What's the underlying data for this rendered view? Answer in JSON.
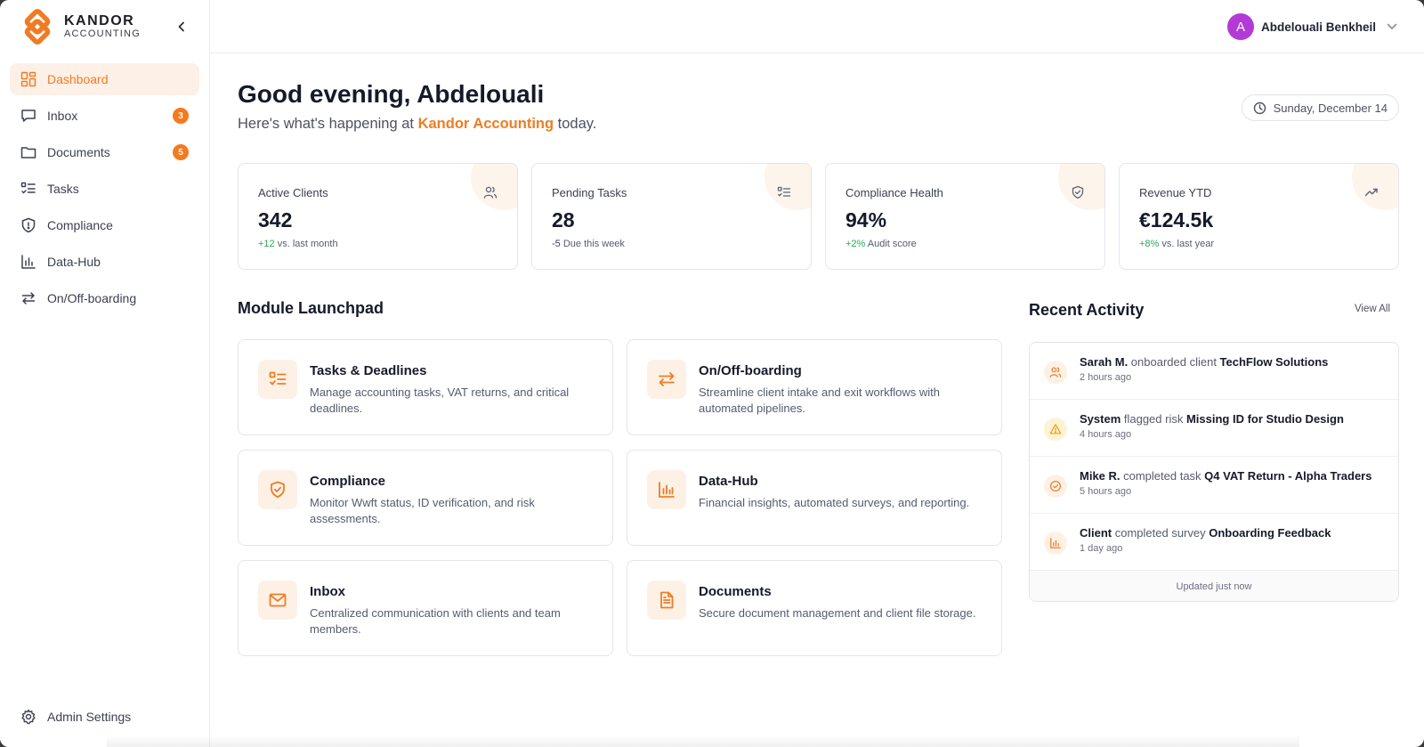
{
  "colors": {
    "accent": "#ef7d22",
    "badge": "#f47a20",
    "positive": "#2aa85a",
    "avatar": "#b33ad6",
    "warning": "#e8a10f"
  },
  "brand": {
    "name": "KANDOR",
    "sub": "ACCOUNTING"
  },
  "sidebar": {
    "collapse_icon": "chevron-left-icon",
    "items": [
      {
        "label": "Dashboard",
        "icon": "dashboard-icon",
        "active": true
      },
      {
        "label": "Inbox",
        "icon": "message-icon",
        "badge": "3"
      },
      {
        "label": "Documents",
        "icon": "folder-icon",
        "badge": "5"
      },
      {
        "label": "Tasks",
        "icon": "task-list-icon"
      },
      {
        "label": "Compliance",
        "icon": "shield-icon"
      },
      {
        "label": "Data-Hub",
        "icon": "bar-chart-icon"
      },
      {
        "label": "On/Off-boarding",
        "icon": "transfer-icon"
      }
    ],
    "admin": {
      "label": "Admin Settings",
      "icon": "gear-icon"
    }
  },
  "topbar": {
    "user": {
      "initial": "A",
      "name": "Abdelouali Benkheil"
    }
  },
  "header": {
    "greeting": "Good evening, Abdelouali",
    "sub_prefix": "Here's what's happening at ",
    "sub_brand": "Kandor Accounting",
    "sub_suffix": " today.",
    "date": "Sunday, December 14"
  },
  "stats": [
    {
      "label": "Active Clients",
      "value": "342",
      "delta": "+12",
      "note": " vs. last month",
      "icon": "users-icon"
    },
    {
      "label": "Pending Tasks",
      "value": "28",
      "delta": "-5",
      "note": " Due this week",
      "icon": "task-list-icon"
    },
    {
      "label": "Compliance Health",
      "value": "94%",
      "delta": "+2%",
      "note": " Audit score",
      "icon": "shield-check-icon"
    },
    {
      "label": "Revenue YTD",
      "value": "€124.5k",
      "delta": "+8%",
      "note": " vs. last year",
      "icon": "trending-up-icon"
    }
  ],
  "launchpad": {
    "title": "Module Launchpad",
    "modules": [
      {
        "title": "Tasks & Deadlines",
        "desc": "Manage accounting tasks, VAT returns, and critical deadlines.",
        "icon": "task-list-icon"
      },
      {
        "title": "On/Off-boarding",
        "desc": "Streamline client intake and exit workflows with automated pipelines.",
        "icon": "transfer-icon"
      },
      {
        "title": "Compliance",
        "desc": "Monitor Wwft status, ID verification, and risk assessments.",
        "icon": "shield-check-icon"
      },
      {
        "title": "Data-Hub",
        "desc": "Financial insights, automated surveys, and reporting.",
        "icon": "bar-chart-icon"
      },
      {
        "title": "Inbox",
        "desc": "Centralized communication with clients and team members.",
        "icon": "mail-icon"
      },
      {
        "title": "Documents",
        "desc": "Secure document management and client file storage.",
        "icon": "file-icon"
      }
    ]
  },
  "recent": {
    "title": "Recent Activity",
    "view_all": "View All",
    "items": [
      {
        "actor": "Sarah M.",
        "action": " onboarded client ",
        "target": "TechFlow Solutions",
        "time": "2 hours ago",
        "icon": "users-icon"
      },
      {
        "actor": "System",
        "action": " flagged risk ",
        "target": "Missing ID for Studio Design",
        "time": "4 hours ago",
        "icon": "warning-icon"
      },
      {
        "actor": "Mike R.",
        "action": " completed task ",
        "target": "Q4 VAT Return - Alpha Traders",
        "time": "5 hours ago",
        "icon": "check-circle-icon"
      },
      {
        "actor": "Client",
        "action": " completed survey ",
        "target": "Onboarding Feedback",
        "time": "1 day ago",
        "icon": "bar-chart-icon"
      }
    ],
    "footer": "Updated just now"
  }
}
